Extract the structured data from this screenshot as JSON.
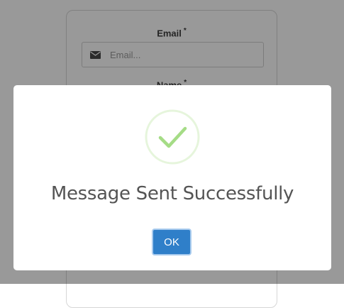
{
  "form": {
    "email_label": "Email",
    "email_required_marker": "*",
    "email_placeholder": "Email...",
    "email_icon": "envelope-icon",
    "name_label": "Name",
    "name_required_marker": "*"
  },
  "modal": {
    "icon": "success-checkmark-icon",
    "title": "Message Sent Successfully",
    "ok_label": "OK",
    "colors": {
      "check": "#a5dc86",
      "check_ring": "#e6f5dc",
      "button": "#2f7fc9",
      "title": "#545454"
    }
  }
}
